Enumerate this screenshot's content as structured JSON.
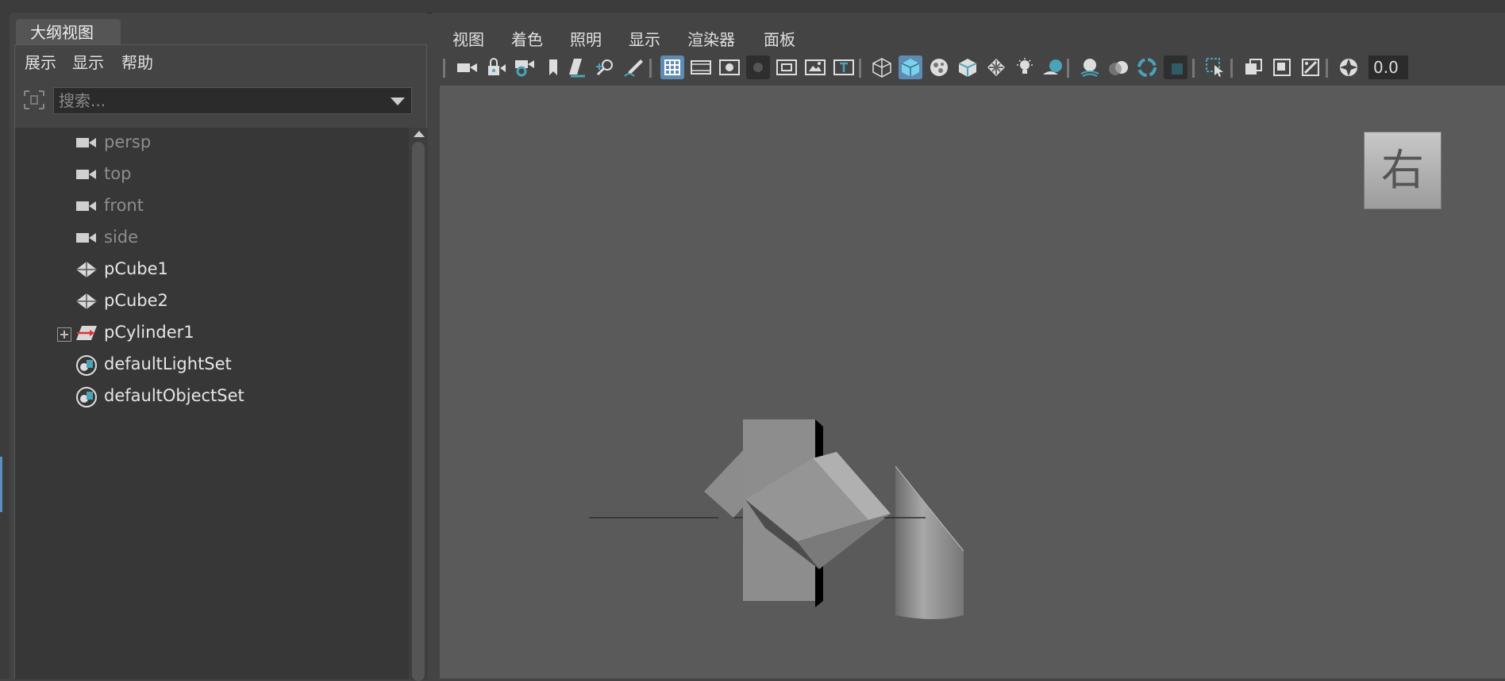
{
  "outliner": {
    "tab_title": "大纲视图",
    "menu": [
      "展示",
      "显示",
      "帮助"
    ],
    "search_placeholder": "搜索...",
    "items": [
      {
        "label": "persp",
        "icon": "camera-icon",
        "dim": true
      },
      {
        "label": "top",
        "icon": "camera-icon",
        "dim": true
      },
      {
        "label": "front",
        "icon": "camera-icon",
        "dim": true
      },
      {
        "label": "side",
        "icon": "camera-icon",
        "dim": true
      },
      {
        "label": "pCube1",
        "icon": "mesh-icon",
        "dim": false
      },
      {
        "label": "pCube2",
        "icon": "mesh-icon",
        "dim": false
      },
      {
        "label": "pCylinder1",
        "icon": "transform-icon",
        "dim": false,
        "expandable": true
      },
      {
        "label": "defaultLightSet",
        "icon": "set-icon",
        "dim": false
      },
      {
        "label": "defaultObjectSet",
        "icon": "set-icon",
        "dim": false
      }
    ]
  },
  "viewport": {
    "menu": [
      "视图",
      "着色",
      "照明",
      "显示",
      "渲染器",
      "面板"
    ],
    "zoom_value": "0.0",
    "viewcube_label": "右",
    "toolbar_icons": [
      "select-camera-icon",
      "lock-camera-icon",
      "camera-attributes-icon",
      "bookmark-icon",
      "image-plane-icon",
      "2d-pan-zoom-icon",
      "grease-pencil-icon",
      "grid-icon",
      "film-gate-icon",
      "resolution-gate-icon",
      "gate-mask-icon",
      "field-chart-icon",
      "safe-action-icon",
      "safe-title-icon",
      "wireframe-icon",
      "smooth-shade-icon",
      "use-default-material-icon",
      "wireframe-on-shaded-icon",
      "textured-icon",
      "use-all-lights-icon",
      "shadows-icon",
      "screen-space-ao-icon",
      "motion-blur-icon",
      "multisample-aa-icon",
      "depth-of-field-icon",
      "isolate-select-icon",
      "xray-icon",
      "xray-joints-icon",
      "xray-active-icon",
      "backface-culling-icon",
      "exposure-icon"
    ],
    "accent_color": "#5d8bb3"
  }
}
